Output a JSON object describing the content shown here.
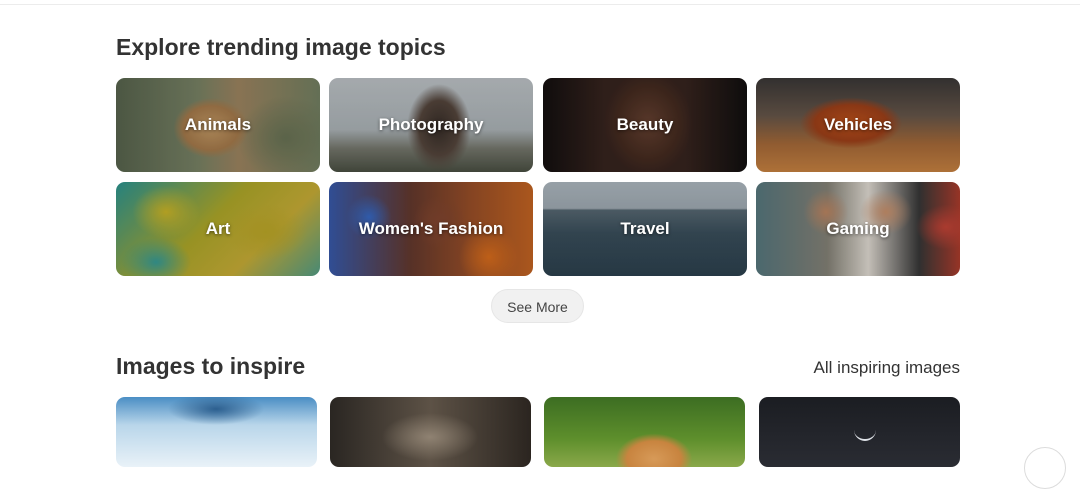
{
  "trending": {
    "title": "Explore trending image topics",
    "topics": [
      {
        "label": "Animals"
      },
      {
        "label": "Photography"
      },
      {
        "label": "Beauty"
      },
      {
        "label": "Vehicles"
      },
      {
        "label": "Art"
      },
      {
        "label": "Women's Fashion"
      },
      {
        "label": "Travel"
      },
      {
        "label": "Gaming"
      }
    ],
    "see_more_label": "See More"
  },
  "inspire": {
    "title": "Images to inspire",
    "all_link_label": "All inspiring images"
  },
  "colors": {
    "background": "#ffffff",
    "heading": "#333333",
    "pill": "#f1f1f1"
  }
}
